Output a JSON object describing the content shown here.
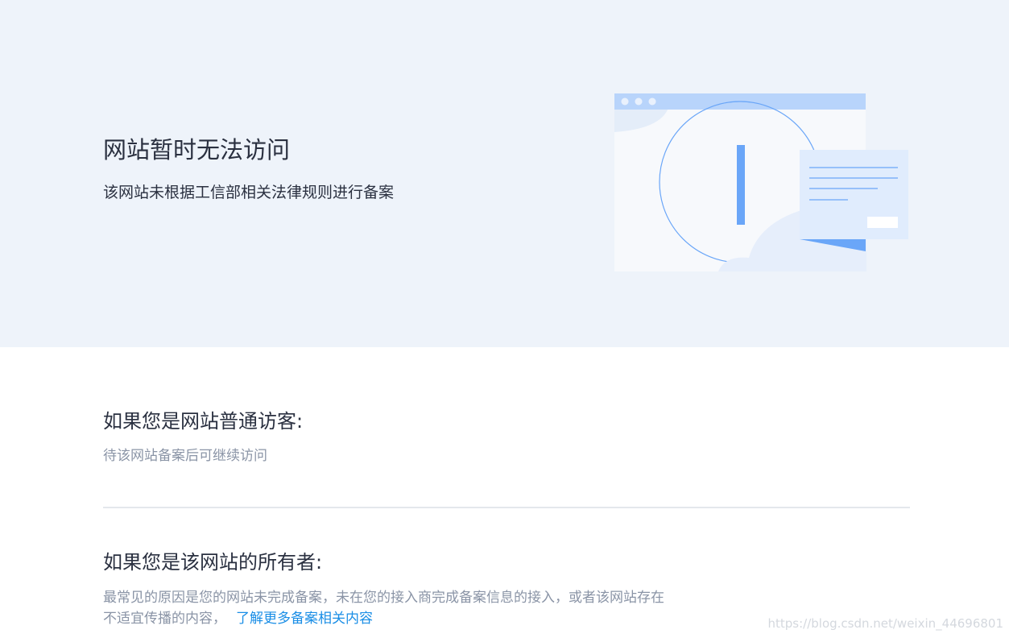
{
  "hero": {
    "title": "网站暂时无法访问",
    "subtitle": "该网站未根据工信部相关法律规则进行备案"
  },
  "illustration": {
    "icon": "browser-warning-illustration",
    "accent_color": "#6aa6f8",
    "bar_color": "#b8d4fb"
  },
  "visitor_section": {
    "heading": "如果您是网站普通访客:",
    "text": "待该网站备案后可继续访问"
  },
  "owner_section": {
    "heading": "如果您是该网站的所有者:",
    "text_line1": "最常见的原因是您的网站未完成备案，未在您的接入商完成备案信息的接入，或者该网站存在",
    "text_line2": "不适宜传播的内容，",
    "link_label": "了解更多备案相关内容",
    "link_color": "#1a8ee6"
  },
  "watermark": "https://blog.csdn.net/weixin_44696801"
}
